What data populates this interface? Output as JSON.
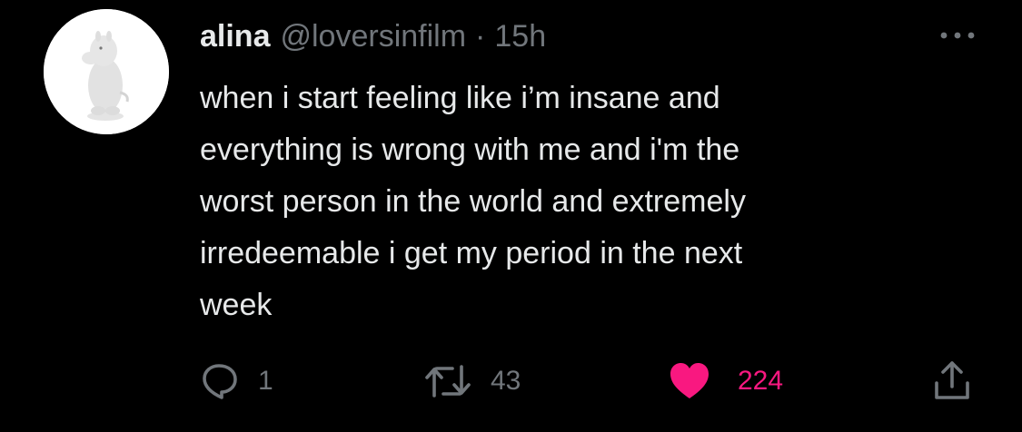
{
  "tweet": {
    "author": {
      "display_name": "alina",
      "handle": "@loversinfilm",
      "separator": "·",
      "time": "15h",
      "avatar_icon": "moomin-figure-avatar"
    },
    "text": "when i start feeling like i’m insane and\neverything is wrong with me and i'm the\nworst person in the world and extremely\nirredeemable i get my period in the next\nweek",
    "actions": {
      "reply": {
        "icon": "reply-icon",
        "count": "1"
      },
      "retweet": {
        "icon": "retweet-icon",
        "count": "43"
      },
      "like": {
        "icon": "heart-icon",
        "count": "224",
        "liked": true,
        "color": "#f91880"
      },
      "share": {
        "icon": "share-icon"
      }
    },
    "more_icon": "more-icon"
  },
  "colors": {
    "background": "#000000",
    "text": "#e7e9ea",
    "muted": "#71767b",
    "like": "#f91880"
  }
}
